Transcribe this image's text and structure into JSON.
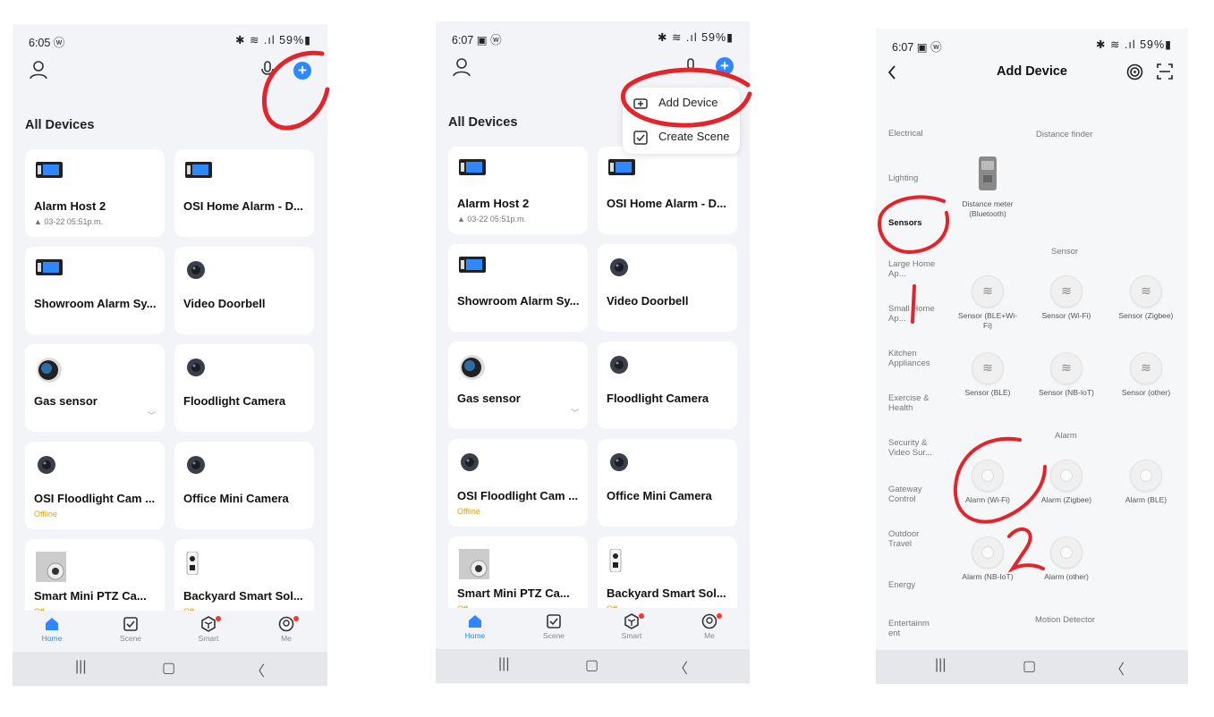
{
  "screen1": {
    "status": {
      "time": "6:05 ⓦ",
      "right": "✱ ≋ .ıl 59%▮"
    },
    "section_title": "All Devices",
    "more": "···",
    "devices": [
      {
        "name": "Alarm Host 2",
        "sub": "▲ 03-22 05:51p.m."
      },
      {
        "name": "OSI Home Alarm - D...",
        "sub": ""
      },
      {
        "name": "Showroom Alarm Sy...",
        "sub": ""
      },
      {
        "name": "Video Doorbell",
        "sub": ""
      },
      {
        "name": "Gas sensor",
        "sub": ""
      },
      {
        "name": "Floodlight Camera",
        "sub": ""
      },
      {
        "name": "OSI Floodlight Cam ...",
        "sub": "Offline"
      },
      {
        "name": "Office Mini Camera",
        "sub": ""
      },
      {
        "name": "Smart Mini PTZ Ca...",
        "sub": "Off"
      },
      {
        "name": "Backyard Smart Sol...",
        "sub": "Off"
      }
    ],
    "tabs": [
      "Home",
      "Scene",
      "Smart",
      "Me"
    ]
  },
  "screen2": {
    "status": {
      "time": "6:07 ▣ ⓦ",
      "right": "✱ ≋ .ıl 59%▮"
    },
    "section_title": "All Devices",
    "menu": {
      "add_device": "Add Device",
      "create_scene": "Create Scene"
    },
    "devices": [
      {
        "name": "Alarm Host 2",
        "sub": "▲ 03-22 05:51p.m."
      },
      {
        "name": "OSI Home Alarm - D...",
        "sub": ""
      },
      {
        "name": "Showroom Alarm Sy...",
        "sub": ""
      },
      {
        "name": "Video Doorbell",
        "sub": ""
      },
      {
        "name": "Gas sensor",
        "sub": ""
      },
      {
        "name": "Floodlight Camera",
        "sub": ""
      },
      {
        "name": "OSI Floodlight Cam ...",
        "sub": "Offline"
      },
      {
        "name": "Office Mini Camera",
        "sub": ""
      },
      {
        "name": "Smart Mini PTZ Ca...",
        "sub": "Off"
      },
      {
        "name": "Backyard Smart Sol...",
        "sub": "Off"
      }
    ],
    "tabs": [
      "Home",
      "Scene",
      "Smart",
      "Me"
    ]
  },
  "screen3": {
    "status": {
      "time": "6:07 ▣ ⓦ",
      "right": "✱ ≋ .ıl 59%▮"
    },
    "title": "Add Device",
    "categories": [
      "Electrical",
      "Lighting",
      "Sensors",
      "Large Home Ap...",
      "Small Home Ap...",
      "Kitchen Appliances",
      "Exercise & Health",
      "Security & Video Sur...",
      "Gateway Control",
      "Outdoor Travel",
      "Energy",
      "Entertainm ent"
    ],
    "groups": {
      "distance": "Distance finder",
      "sensor": "Sensor",
      "alarm": "Alarm",
      "motion": "Motion Detector"
    },
    "distance_item": "Distance meter (Bluetooth)",
    "sensor_items": [
      "Sensor (BLE+Wi-Fi)",
      "Sensor (Wi-Fi)",
      "Sensor (Zigbee)",
      "Sensor (BLE)",
      "Sensor (NB-IoT)",
      "Sensor (other)"
    ],
    "alarm_items": [
      "Alarm (Wi-Fi)",
      "Alarm (Zigbee)",
      "Alarm (BLE)",
      "Alarm (NB-IoT)",
      "Alarm (other)"
    ],
    "annotation_1": "1",
    "annotation_2": "2"
  },
  "colors": {
    "accent": "#2f88ff",
    "annotation": "#e3242b",
    "offline": "#e0a200"
  }
}
